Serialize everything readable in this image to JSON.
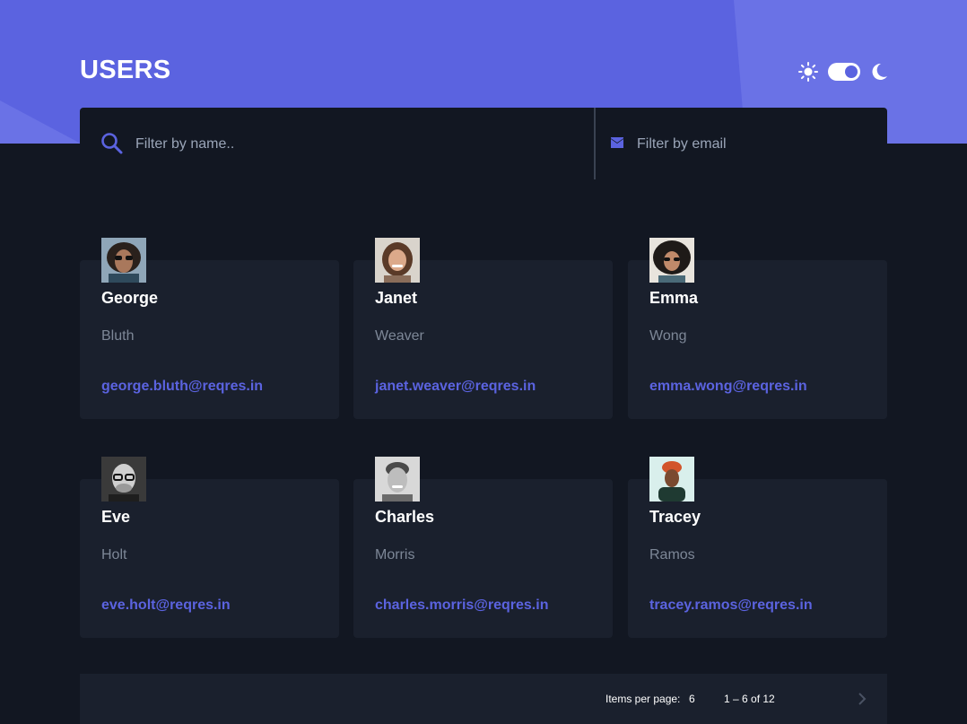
{
  "header": {
    "title": "USERS",
    "theme_toggle": {
      "left_icon": "sun-icon",
      "right_icon": "moon-icon",
      "state": "dark"
    }
  },
  "filters": {
    "name_placeholder": "Filter by name..",
    "name_icon": "search-icon",
    "email_placeholder": "Filter by email",
    "email_icon": "envelope-icon"
  },
  "users": [
    {
      "first_name": "George",
      "last_name": "Bluth",
      "email": "george.bluth@reqres.in"
    },
    {
      "first_name": "Janet",
      "last_name": "Weaver",
      "email": "janet.weaver@reqres.in"
    },
    {
      "first_name": "Emma",
      "last_name": "Wong",
      "email": "emma.wong@reqres.in"
    },
    {
      "first_name": "Eve",
      "last_name": "Holt",
      "email": "eve.holt@reqres.in"
    },
    {
      "first_name": "Charles",
      "last_name": "Morris",
      "email": "charles.morris@reqres.in"
    },
    {
      "first_name": "Tracey",
      "last_name": "Ramos",
      "email": "tracey.ramos@reqres.in"
    }
  ],
  "paginator": {
    "items_per_page_label": "Items per page:",
    "items_per_page": "6",
    "range_label": "1 – 6 of 12",
    "next_icon": "chevron-right-icon"
  },
  "colors": {
    "accent": "#5b63e0",
    "background": "#121722",
    "card": "#1a202d",
    "muted_text": "#7d8797"
  }
}
